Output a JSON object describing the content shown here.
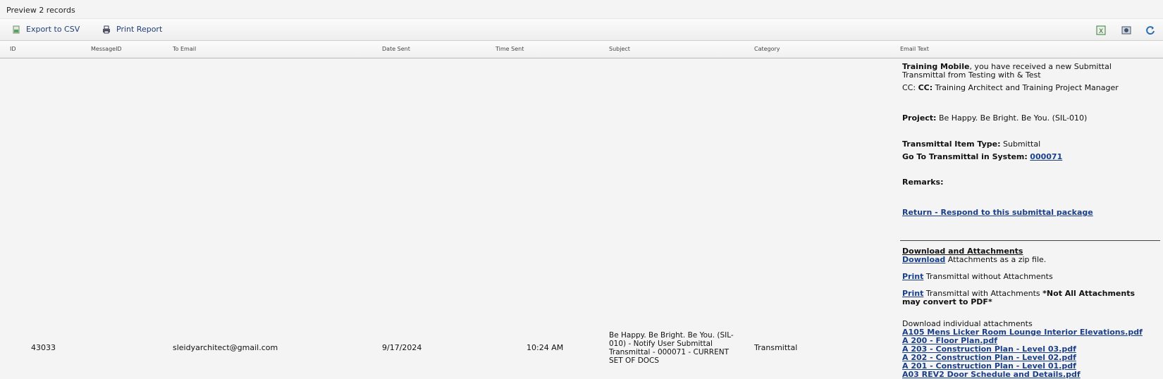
{
  "title": "Preview 2 records",
  "toolbar": {
    "export_csv": "Export to CSV",
    "print_report": "Print Report",
    "icons": [
      "csv-icon",
      "print-icon",
      "excel-icon",
      "settings-icon",
      "refresh-icon"
    ]
  },
  "columns": [
    "ID",
    "MessageID",
    "To Email",
    "Date Sent",
    "Time Sent",
    "Subject",
    "Category",
    "Email Text"
  ],
  "row": {
    "message_id": "43033",
    "to_email": "sleidyarchitect@gmail.com",
    "date_sent": "9/17/2024",
    "time_sent": "10:24 AM",
    "subject": "Be Happy. Be Bright. Be You. (SIL-010) - Notify User Submittal Transmittal - 000071 - CURRENT SET OF DOCS",
    "category": "Transmittal"
  },
  "email_text": {
    "recipient": "Training Mobile",
    "intro_rest": ", you have received a new Submittal Transmittal from Testing with & Test",
    "cc_prefix": "CC: ",
    "cc_label": "CC:",
    "cc_value": " Training Architect and Training Project Manager",
    "project_label": "Project:",
    "project_value": " Be Happy. Be Bright. Be You. (SIL-010)",
    "item_type_label": "Transmittal Item Type:",
    "item_type_value": " Submittal",
    "goto_label": "Go To Transmittal in System:",
    "goto_link": "000071",
    "remarks_label": "Remarks:",
    "return_link": "Return - Respond to this submittal package",
    "download_heading": "Download and Attachments",
    "download_link": "Download",
    "download_rest": " Attachments as a zip file.",
    "print1_link": "Print",
    "print1_rest": " Transmittal without Attachments",
    "print2_link": "Print",
    "print2_rest": " Transmittal with Attachments ",
    "print2_note": "*Not All Attachments may convert to PDF*",
    "individual_label": "Download individual attachments",
    "attachments": [
      "A105 Mens Licker Room Lounge Interior Elevations.pdf",
      "A 200 - Floor Plan.pdf",
      "A 203 - Construction Plan - Level 03.pdf",
      "A 202 - Construction Plan - Level 02.pdf",
      "A 201 - Construction Plan - Level 01.pdf",
      "A03 REV2 Door Schedule and Details.pdf"
    ]
  }
}
